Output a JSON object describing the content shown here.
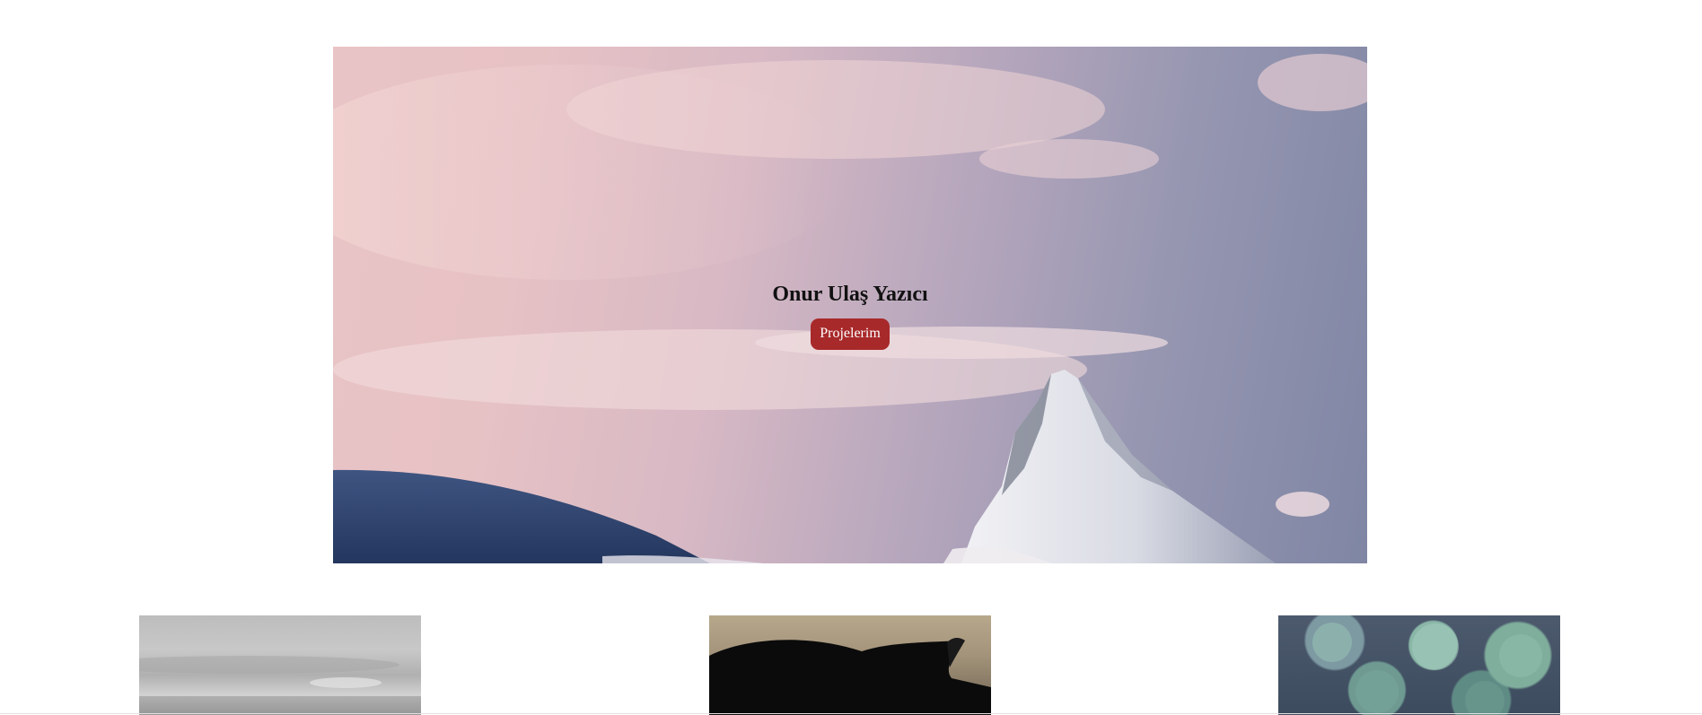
{
  "hero": {
    "title": "Onur Ulaş Yazıcı",
    "button_label": "Projelerim",
    "button_color": "#a8292a"
  },
  "gallery": {
    "items": [
      {
        "image": "grey-landscape-image"
      },
      {
        "image": "horse-image"
      },
      {
        "image": "succulent-plants-image"
      }
    ]
  }
}
